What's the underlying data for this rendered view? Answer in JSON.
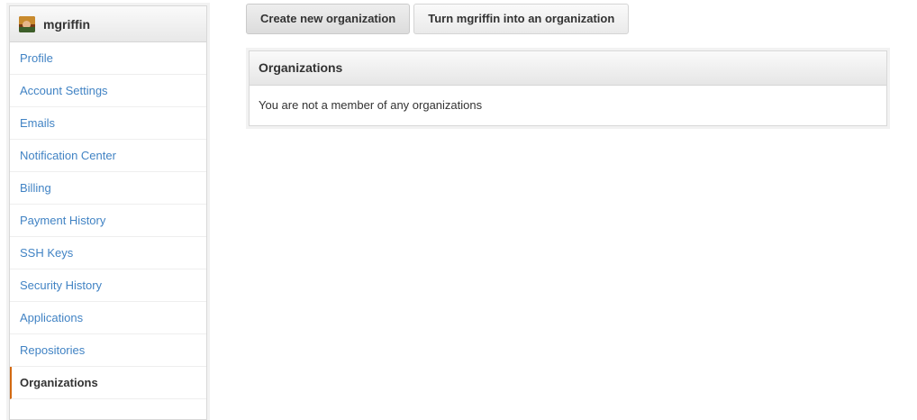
{
  "sidebar": {
    "username": "mgriffin",
    "avatar_icon": "user-avatar",
    "items": [
      {
        "label": "Profile"
      },
      {
        "label": "Account Settings"
      },
      {
        "label": "Emails"
      },
      {
        "label": "Notification Center"
      },
      {
        "label": "Billing"
      },
      {
        "label": "Payment History"
      },
      {
        "label": "SSH Keys"
      },
      {
        "label": "Security History"
      },
      {
        "label": "Applications"
      },
      {
        "label": "Repositories"
      },
      {
        "label": "Organizations"
      }
    ],
    "selected": "Organizations"
  },
  "actions": {
    "create_label": "Create new organization",
    "turn_label": "Turn mgriffin into an organization"
  },
  "organizations_box": {
    "title": "Organizations",
    "empty_message": "You are not a member of any organizations"
  },
  "colors": {
    "link": "#4183c4",
    "selected_indicator": "#d26911"
  }
}
